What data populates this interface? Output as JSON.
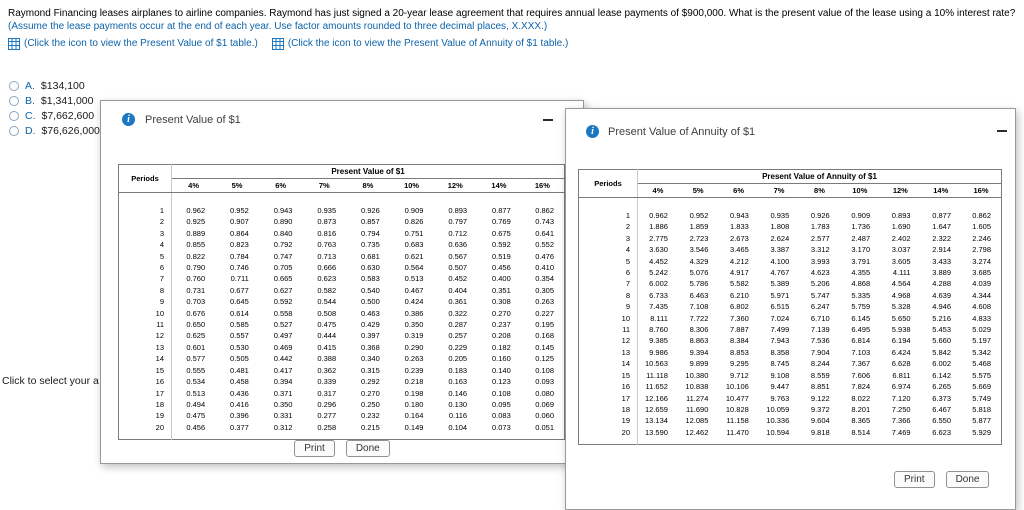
{
  "colors": {
    "link_blue": "#0e63a9",
    "info_icon_blue": "#1c77c3"
  },
  "icons": {
    "info": "i"
  },
  "page": {
    "question": {
      "main": "Raymond Financing leases airplanes to airline companies. Raymond has just signed a 20-year lease agreement that requires annual lease payments of $900,000. What is the present value of the lease using a 10% interest rate? ",
      "assumption": "(Assume the lease payments occur at the end of each year. Use factor amounts rounded to three decimal places, X.XXX.)"
    },
    "table_links": [
      "(Click the icon to view the Present Value of $1 table.)",
      "(Click the icon to view the Present Value of Annuity of $1 table.)"
    ],
    "options": [
      {
        "letter": "A.",
        "value": "$134,100"
      },
      {
        "letter": "B.",
        "value": "$1,341,000"
      },
      {
        "letter": "C.",
        "value": "$7,662,600"
      },
      {
        "letter": "D.",
        "value": "$76,626,000"
      }
    ],
    "side_note": "Click to select your a"
  },
  "pv_dialog": {
    "window_title": "Present Value of $1",
    "table": {
      "title": "Present Value of $1",
      "periods_label": "Periods",
      "rate_columns": [
        "4%",
        "5%",
        "6%",
        "7%",
        "8%",
        "10%",
        "12%",
        "14%",
        "16%"
      ],
      "rows": [
        [
          "1",
          "0.962",
          "0.952",
          "0.943",
          "0.935",
          "0.926",
          "0.909",
          "0.893",
          "0.877",
          "0.862"
        ],
        [
          "2",
          "0.925",
          "0.907",
          "0.890",
          "0.873",
          "0.857",
          "0.826",
          "0.797",
          "0.769",
          "0.743"
        ],
        [
          "3",
          "0.889",
          "0.864",
          "0.840",
          "0.816",
          "0.794",
          "0.751",
          "0.712",
          "0.675",
          "0.641"
        ],
        [
          "4",
          "0.855",
          "0.823",
          "0.792",
          "0.763",
          "0.735",
          "0.683",
          "0.636",
          "0.592",
          "0.552"
        ],
        [
          "5",
          "0.822",
          "0.784",
          "0.747",
          "0.713",
          "0.681",
          "0.621",
          "0.567",
          "0.519",
          "0.476"
        ],
        [
          "6",
          "0.790",
          "0.746",
          "0.705",
          "0.666",
          "0.630",
          "0.564",
          "0.507",
          "0.456",
          "0.410"
        ],
        [
          "7",
          "0.760",
          "0.711",
          "0.665",
          "0.623",
          "0.583",
          "0.513",
          "0.452",
          "0.400",
          "0.354"
        ],
        [
          "8",
          "0.731",
          "0.677",
          "0.627",
          "0.582",
          "0.540",
          "0.467",
          "0.404",
          "0.351",
          "0.305"
        ],
        [
          "9",
          "0.703",
          "0.645",
          "0.592",
          "0.544",
          "0.500",
          "0.424",
          "0.361",
          "0.308",
          "0.263"
        ],
        [
          "10",
          "0.676",
          "0.614",
          "0.558",
          "0.508",
          "0.463",
          "0.386",
          "0.322",
          "0.270",
          "0.227"
        ],
        [
          "11",
          "0.650",
          "0.585",
          "0.527",
          "0.475",
          "0.429",
          "0.350",
          "0.287",
          "0.237",
          "0.195"
        ],
        [
          "12",
          "0.625",
          "0.557",
          "0.497",
          "0.444",
          "0.397",
          "0.319",
          "0.257",
          "0.208",
          "0.168"
        ],
        [
          "13",
          "0.601",
          "0.530",
          "0.469",
          "0.415",
          "0.368",
          "0.290",
          "0.229",
          "0.182",
          "0.145"
        ],
        [
          "14",
          "0.577",
          "0.505",
          "0.442",
          "0.388",
          "0.340",
          "0.263",
          "0.205",
          "0.160",
          "0.125"
        ],
        [
          "15",
          "0.555",
          "0.481",
          "0.417",
          "0.362",
          "0.315",
          "0.239",
          "0.183",
          "0.140",
          "0.108"
        ],
        [
          "16",
          "0.534",
          "0.458",
          "0.394",
          "0.339",
          "0.292",
          "0.218",
          "0.163",
          "0.123",
          "0.093"
        ],
        [
          "17",
          "0.513",
          "0.436",
          "0.371",
          "0.317",
          "0.270",
          "0.198",
          "0.146",
          "0.108",
          "0.080"
        ],
        [
          "18",
          "0.494",
          "0.416",
          "0.350",
          "0.296",
          "0.250",
          "0.180",
          "0.130",
          "0.095",
          "0.069"
        ],
        [
          "19",
          "0.475",
          "0.396",
          "0.331",
          "0.277",
          "0.232",
          "0.164",
          "0.116",
          "0.083",
          "0.060"
        ],
        [
          "20",
          "0.456",
          "0.377",
          "0.312",
          "0.258",
          "0.215",
          "0.149",
          "0.104",
          "0.073",
          "0.051"
        ]
      ]
    },
    "buttons": {
      "print": "Print",
      "done": "Done"
    }
  },
  "pva_dialog": {
    "window_title": "Present Value of Annuity of $1",
    "table": {
      "title": "Present Value of Annuity of $1",
      "periods_label": "Periods",
      "rate_columns": [
        "4%",
        "5%",
        "6%",
        "7%",
        "8%",
        "10%",
        "12%",
        "14%",
        "16%"
      ],
      "rows": [
        [
          "1",
          "0.962",
          "0.952",
          "0.943",
          "0.935",
          "0.926",
          "0.909",
          "0.893",
          "0.877",
          "0.862"
        ],
        [
          "2",
          "1.886",
          "1.859",
          "1.833",
          "1.808",
          "1.783",
          "1.736",
          "1.690",
          "1.647",
          "1.605"
        ],
        [
          "3",
          "2.775",
          "2.723",
          "2.673",
          "2.624",
          "2.577",
          "2.487",
          "2.402",
          "2.322",
          "2.246"
        ],
        [
          "4",
          "3.630",
          "3.546",
          "3.465",
          "3.387",
          "3.312",
          "3.170",
          "3.037",
          "2.914",
          "2.798"
        ],
        [
          "5",
          "4.452",
          "4.329",
          "4.212",
          "4.100",
          "3.993",
          "3.791",
          "3.605",
          "3.433",
          "3.274"
        ],
        [
          "6",
          "5.242",
          "5.076",
          "4.917",
          "4.767",
          "4.623",
          "4.355",
          "4.111",
          "3.889",
          "3.685"
        ],
        [
          "7",
          "6.002",
          "5.786",
          "5.582",
          "5.389",
          "5.206",
          "4.868",
          "4.564",
          "4.288",
          "4.039"
        ],
        [
          "8",
          "6.733",
          "6.463",
          "6.210",
          "5.971",
          "5.747",
          "5.335",
          "4.968",
          "4.639",
          "4.344"
        ],
        [
          "9",
          "7.435",
          "7.108",
          "6.802",
          "6.515",
          "6.247",
          "5.759",
          "5.328",
          "4.946",
          "4.608"
        ],
        [
          "10",
          "8.111",
          "7.722",
          "7.360",
          "7.024",
          "6.710",
          "6.145",
          "5.650",
          "5.216",
          "4.833"
        ],
        [
          "11",
          "8.760",
          "8.306",
          "7.887",
          "7.499",
          "7.139",
          "6.495",
          "5.938",
          "5.453",
          "5.029"
        ],
        [
          "12",
          "9.385",
          "8.863",
          "8.384",
          "7.943",
          "7.536",
          "6.814",
          "6.194",
          "5.660",
          "5.197"
        ],
        [
          "13",
          "9.986",
          "9.394",
          "8.853",
          "8.358",
          "7.904",
          "7.103",
          "6.424",
          "5.842",
          "5.342"
        ],
        [
          "14",
          "10.563",
          "9.899",
          "9.295",
          "8.745",
          "8.244",
          "7.367",
          "6.628",
          "6.002",
          "5.468"
        ],
        [
          "15",
          "11.118",
          "10.380",
          "9.712",
          "9.108",
          "8.559",
          "7.606",
          "6.811",
          "6.142",
          "5.575"
        ],
        [
          "16",
          "11.652",
          "10.838",
          "10.106",
          "9.447",
          "8.851",
          "7.824",
          "6.974",
          "6.265",
          "5.669"
        ],
        [
          "17",
          "12.166",
          "11.274",
          "10.477",
          "9.763",
          "9.122",
          "8.022",
          "7.120",
          "6.373",
          "5.749"
        ],
        [
          "18",
          "12.659",
          "11.690",
          "10.828",
          "10.059",
          "9.372",
          "8.201",
          "7.250",
          "6.467",
          "5.818"
        ],
        [
          "19",
          "13.134",
          "12.085",
          "11.158",
          "10.336",
          "9.604",
          "8.365",
          "7.366",
          "6.550",
          "5.877"
        ],
        [
          "20",
          "13.590",
          "12.462",
          "11.470",
          "10.594",
          "9.818",
          "8.514",
          "7.469",
          "6.623",
          "5.929"
        ]
      ]
    },
    "buttons": {
      "print": "Print",
      "done": "Done"
    }
  }
}
